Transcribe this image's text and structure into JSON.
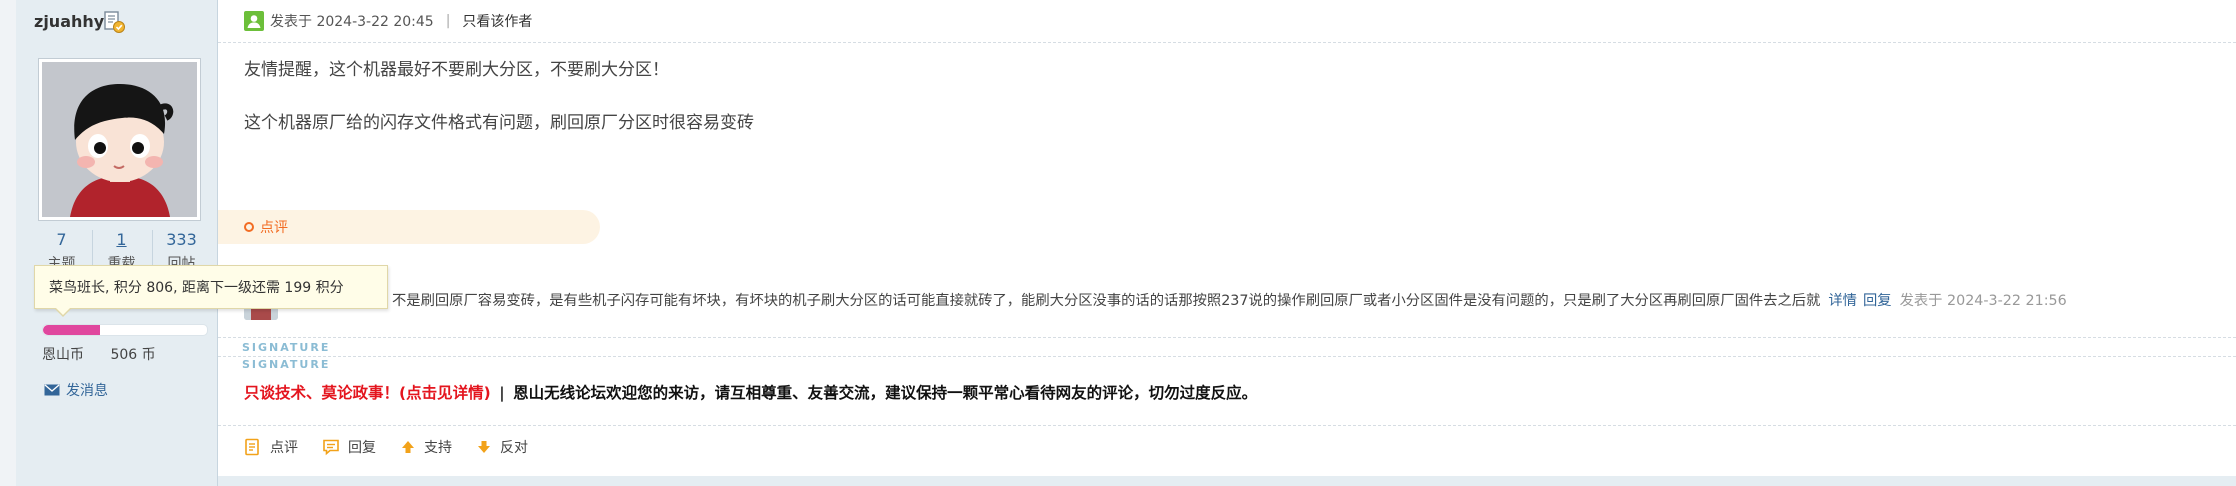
{
  "user": {
    "name": "zjuahhy",
    "stats": [
      {
        "value": "7",
        "label": "主题"
      },
      {
        "value": "1",
        "label": "重载"
      },
      {
        "value": "333",
        "label": "回帖"
      }
    ],
    "rank_tooltip": "菜鸟班长, 积分 806, 距离下一级还需 199 积分",
    "progress_fraction": 0.35,
    "currency_label": "恩山币",
    "currency_value": "506 币",
    "send_message": "发消息"
  },
  "post": {
    "posted_at": "发表于 2024-3-22 20:45",
    "separator": "|",
    "author_only": "只看该作者",
    "content": [
      "友情提醒，这个机器最好不要刷大分区，不要刷大分区！",
      "这个机器原厂给的闪存文件格式有问题，刷回原厂分区时很容易变砖"
    ]
  },
  "comments": {
    "bar_label": "点评",
    "items": [
      {
        "text": "不是刷回原厂容易变砖，是有些机子闪存可能有坏块，有坏块的机子刷大分区的话可能直接就砖了，能刷大分区没事的话的话那按照237说的操作刷回原厂或者小分区固件是没有问题的，只是刷了大分区再刷回原厂固件去之后就",
        "detail_link": "详情",
        "reply_link": "回复",
        "time": "发表于 2024-3-22 21:56"
      }
    ]
  },
  "signature": {
    "labels": [
      "SIGNATURE",
      "SIGNATURE"
    ],
    "red_text": "只谈技术、莫论政事！(点击见详情)",
    "pipe": "|",
    "black_text": "恩山无线论坛欢迎您的来访，请互相尊重、友善交流，建议保持一颗平常心看待网友的评论，切勿过度反应。"
  },
  "actions": [
    {
      "label": "点评",
      "icon": "comment-note-icon"
    },
    {
      "label": "回复",
      "icon": "reply-bubble-icon"
    },
    {
      "label": "支持",
      "icon": "arrow-up-icon"
    },
    {
      "label": "反对",
      "icon": "arrow-down-icon"
    }
  ],
  "colors": {
    "sidebar_bg": "#e5edf2",
    "link": "#336699",
    "comment_accent": "#f26c23",
    "signature_red": "#e4151e",
    "progress_fill": "#e0479e"
  }
}
